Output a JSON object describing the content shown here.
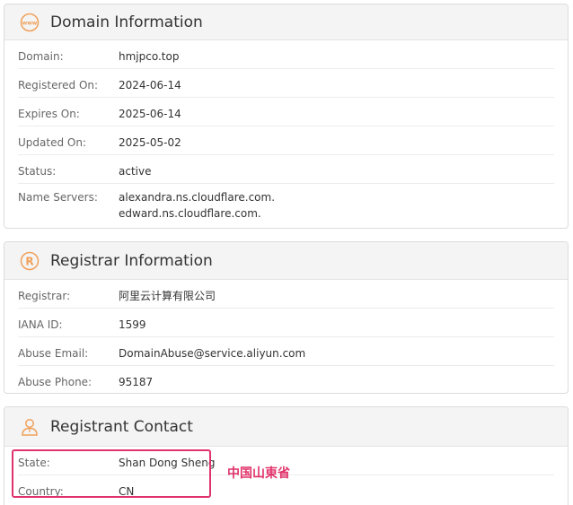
{
  "domain_info": {
    "title": "Domain Information",
    "rows": [
      {
        "label": "Domain:",
        "value": "hmjpco.top"
      },
      {
        "label": "Registered On:",
        "value": "2024-06-14"
      },
      {
        "label": "Expires On:",
        "value": "2025-06-14"
      },
      {
        "label": "Updated On:",
        "value": "2025-05-02"
      },
      {
        "label": "Status:",
        "value": "active"
      },
      {
        "label": "Name Servers:",
        "value": "alexandra.ns.cloudflare.com.",
        "value2": "edward.ns.cloudflare.com."
      }
    ]
  },
  "registrar_info": {
    "title": "Registrar Information",
    "rows": [
      {
        "label": "Registrar:",
        "value": "阿里云计算有限公司"
      },
      {
        "label": "IANA ID:",
        "value": "1599"
      },
      {
        "label": "Abuse Email:",
        "value": "DomainAbuse@service.aliyun.com"
      },
      {
        "label": "Abuse Phone:",
        "value": "95187"
      }
    ]
  },
  "registrant_contact": {
    "title": "Registrant Contact",
    "rows": [
      {
        "label": "State:",
        "value": "Shan Dong Sheng"
      },
      {
        "label": "Country:",
        "value": "CN"
      }
    ]
  },
  "annotation": {
    "text": "中国山東省",
    "color": "#e0336b"
  },
  "colors": {
    "icon_accent": "#f0a05a",
    "highlight": "#e0336b"
  }
}
